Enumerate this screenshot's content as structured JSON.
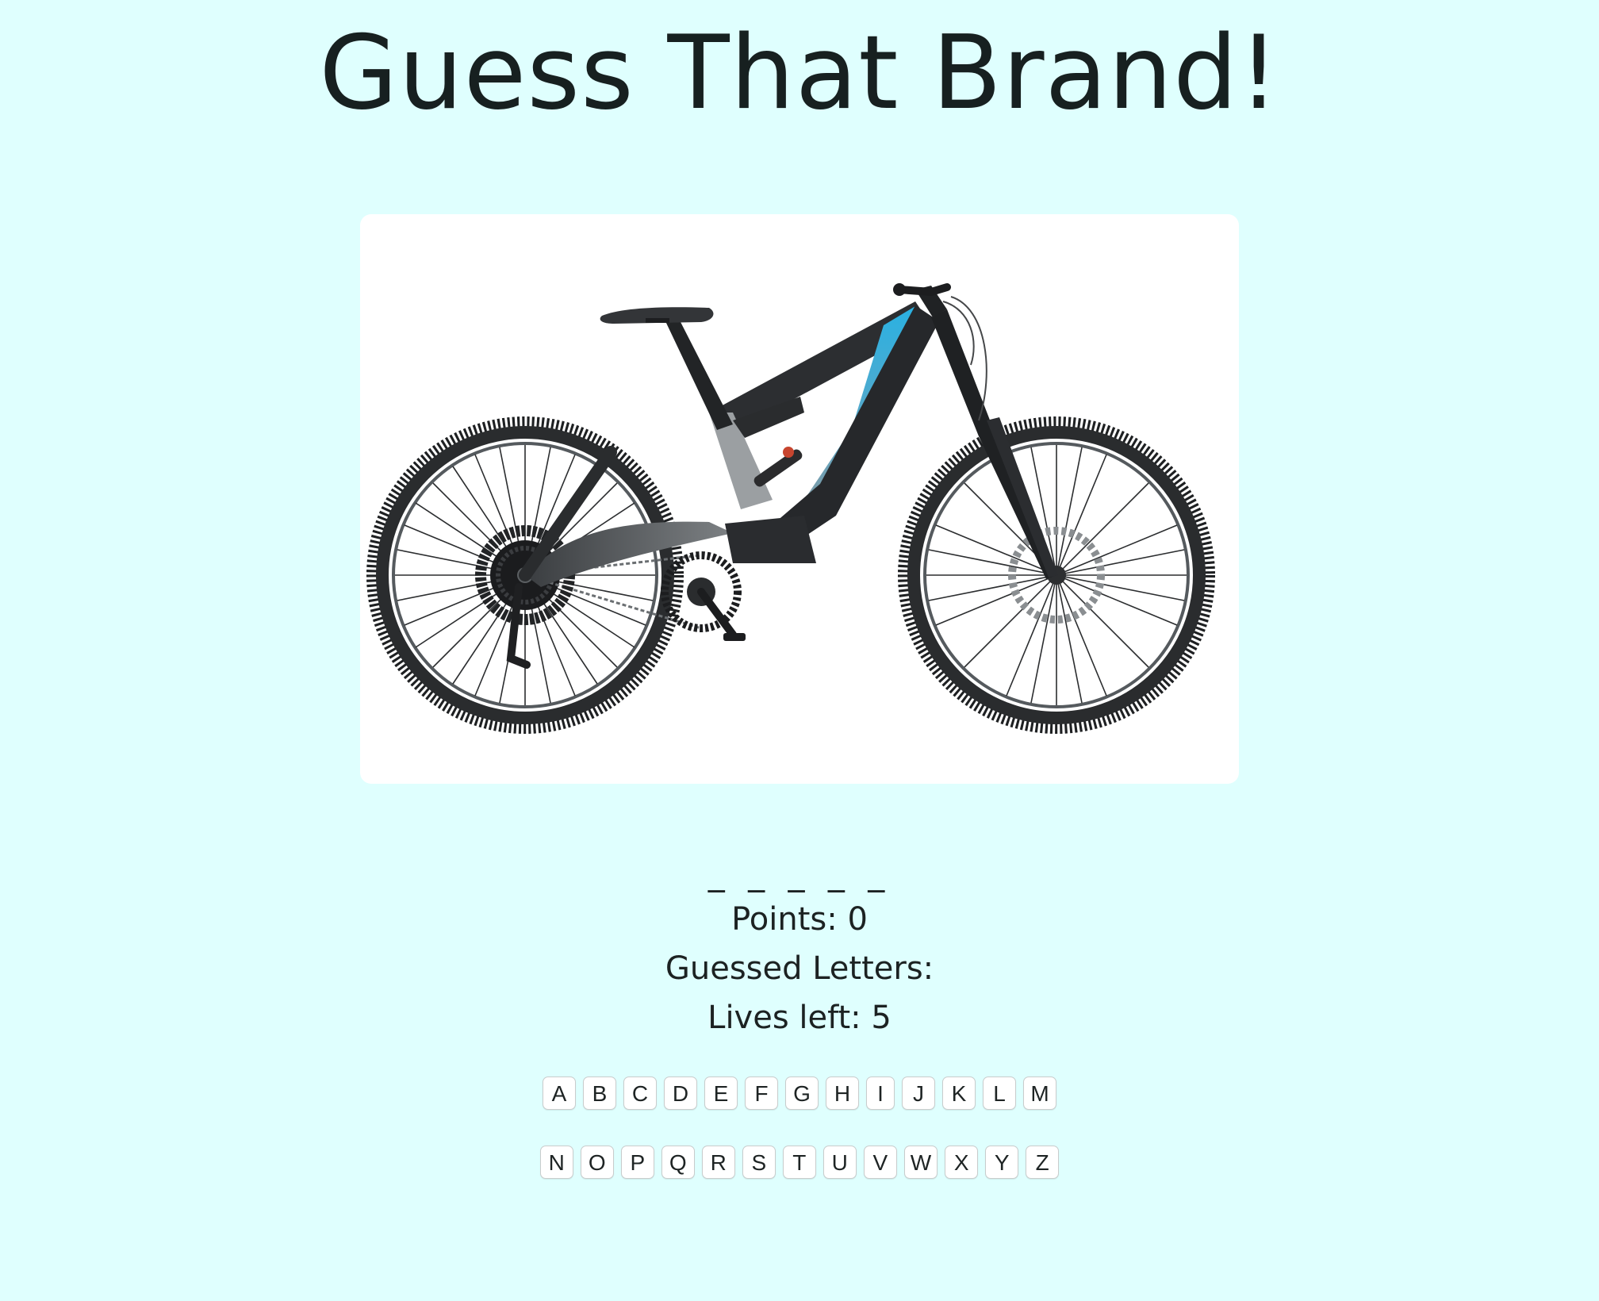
{
  "page": {
    "title": "Guess That Brand!",
    "background_color": "#dffffe"
  },
  "puzzle": {
    "image_subject": "full-suspension mountain bike",
    "accent_color": "#2aa9d8",
    "word_blanks": "_ _ _ _ _"
  },
  "stats": {
    "points_text": "Points: 0",
    "guessed_text": "Guessed Letters:",
    "lives_text": "Lives left: 5"
  },
  "keyboard": {
    "row1": [
      "A",
      "B",
      "C",
      "D",
      "E",
      "F",
      "G",
      "H",
      "I",
      "J",
      "K",
      "L",
      "M"
    ],
    "row2": [
      "N",
      "O",
      "P",
      "Q",
      "R",
      "S",
      "T",
      "U",
      "V",
      "W",
      "X",
      "Y",
      "Z"
    ]
  }
}
